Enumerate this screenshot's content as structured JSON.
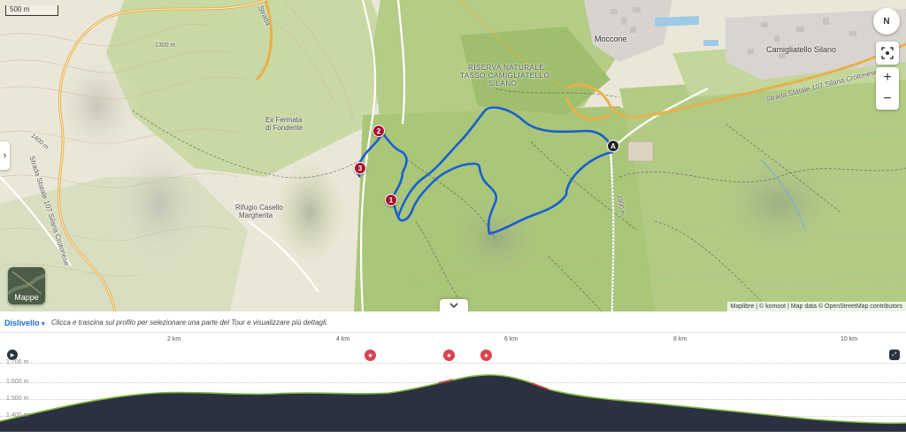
{
  "map": {
    "scale_label": "500 m",
    "compass_label": "N",
    "zoom_in": "+",
    "zoom_out": "−",
    "side_toggle": "›",
    "collapse_icon": "chevron-down-icon",
    "layers_label": "Mappe",
    "attribution": "Maplibre | © komoot | Map data © OpenStreetMap contributors",
    "places": {
      "moccone": "Moccone",
      "camigliatello": "Camigliatello Silano",
      "riserva_l1": "RISERVA NATURALE",
      "riserva_l2": "TASSO   CAMIGLIATELLO",
      "riserva_l3": "SILANO",
      "ex_fermata_l1": "Ex Fermata",
      "ex_fermata_l2": "di Fondente",
      "rifugio_l1": "Rifugio Casello",
      "rifugio_l2": "Margherita"
    },
    "roads": {
      "ss107_left": "Strada Statale 107 Silana Crotonese",
      "ss107_right": "Strada Statale 107 Silana Crotonese",
      "strada_top": "Strada",
      "contour_1300": "1300 m",
      "contour_1400": "1400 m",
      "contour_1500": "1500 m"
    },
    "markers": [
      {
        "label": "1"
      },
      {
        "label": "2"
      },
      {
        "label": "3"
      }
    ],
    "start_marker": "A",
    "route_color": "#1a5fd0",
    "marker_color": "#a3162e"
  },
  "profile": {
    "title": "Dislivello",
    "hint": "Clicca e trascina sul profilo per selezionare una parte del Tour e visualizzare più dettagli.",
    "distance_ticks": [
      "2 km",
      "4 km",
      "6 km",
      "8 km",
      "10 km"
    ],
    "elevation_ticks": [
      "1.700 m",
      "1.600 m",
      "1.500 m",
      "1.400 m"
    ],
    "fill_color": "#2b3140",
    "line_color": "#7fb73c"
  }
}
